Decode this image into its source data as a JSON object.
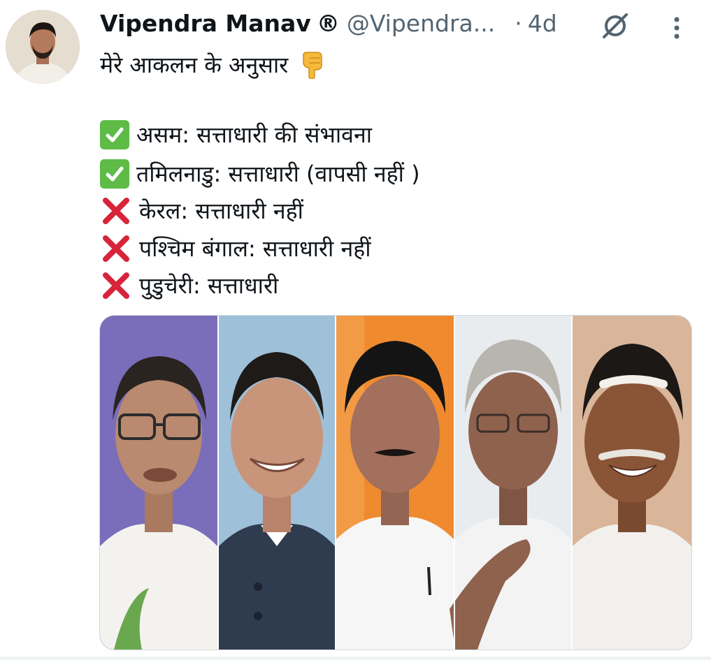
{
  "author": {
    "display_name": "Vipendra Manav",
    "registered_mark": "®",
    "handle": "@Vipendra...",
    "separator": "·",
    "time": "4d",
    "avatar_icon": "profile-photo",
    "grok_icon": "grok-icon",
    "more_icon": "more-vertical-icon"
  },
  "tweet": {
    "intro": "मेरे आकलन के अनुसार",
    "intro_emoji": "👇",
    "lines": [
      {
        "status": "check",
        "text": "असम: सत्ताधारी की संभावना"
      },
      {
        "status": "check",
        "text": "तमिलनाडु: सत्ताधारी (वापसी नहीं )"
      },
      {
        "status": "cross",
        "text": "केरल: सत्ताधारी नहीं"
      },
      {
        "status": "cross",
        "text": "पश्चिम बंगाल: सत्ताधारी नहीं"
      },
      {
        "status": "cross",
        "text": "पुडुचेरी: सत्ताधारी"
      }
    ]
  },
  "media": {
    "portraits": [
      {
        "name": "portrait-1",
        "bg": "#6b5fb0",
        "skin": "#b98a6f",
        "cloth": "#f4f2ee",
        "hair": "#2a2420"
      },
      {
        "name": "portrait-2",
        "bg": "#9fc0d9",
        "skin": "#c8957a",
        "cloth": "#2f3b4f",
        "hair": "#1e1a18"
      },
      {
        "name": "portrait-3",
        "bg": "#f08a2e",
        "skin": "#a2705c",
        "cloth": "#f6f6f6",
        "hair": "#141414"
      },
      {
        "name": "portrait-4",
        "bg": "#e8ecef",
        "skin": "#8f624e",
        "cloth": "#f3f3f3",
        "hair": "#b8b4ae"
      },
      {
        "name": "portrait-5",
        "bg": "#d9b59a",
        "skin": "#8a5436",
        "cloth": "#f2f0ec",
        "hair": "#1c1816"
      }
    ]
  },
  "colors": {
    "text": "#0f1419",
    "secondary": "#536471",
    "check_green": "#5dbb46",
    "cross_red": "#d8243a",
    "divider": "#cfd9de"
  }
}
